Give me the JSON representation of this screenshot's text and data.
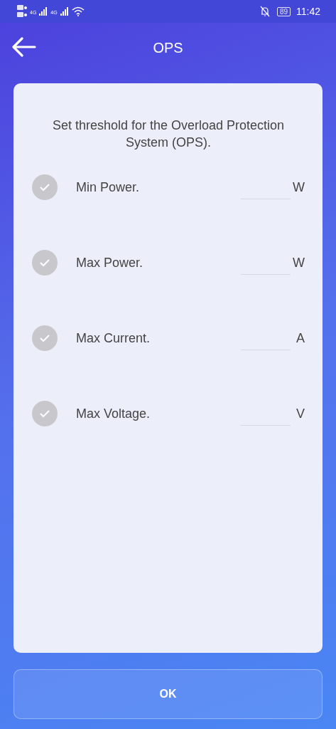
{
  "status_bar": {
    "network_1": "4G",
    "network_2": "4G",
    "battery": "89",
    "time": "11:42"
  },
  "header": {
    "title": "OPS"
  },
  "card": {
    "description": "Set threshold for the Overload Protection System (OPS).",
    "rows": [
      {
        "label": "Min Power.",
        "unit": "W",
        "checked": false
      },
      {
        "label": "Max Power.",
        "unit": "W",
        "checked": false
      },
      {
        "label": "Max Current.",
        "unit": "A",
        "checked": false
      },
      {
        "label": "Max Voltage.",
        "unit": "V",
        "checked": false
      }
    ]
  },
  "ok_button": {
    "label": "OK"
  }
}
